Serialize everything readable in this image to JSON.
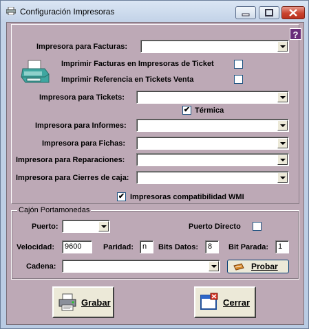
{
  "window": {
    "title": "Configuración Impresoras"
  },
  "help": {
    "label": "?"
  },
  "facturas": {
    "label": "Impresora para Facturas:",
    "value": "",
    "imprimir_ticket_label": "Imprimir Facturas en Impresoras de Ticket",
    "imprimir_ticket_checked": false,
    "imprimir_ref_label": "Imprimir Referencia en Tickets Venta",
    "imprimir_ref_checked": false
  },
  "tickets": {
    "label": "Impresora para Tickets:",
    "value": "",
    "termica_label": "Térmica",
    "termica_checked": true
  },
  "informes": {
    "label": "Impresora para Informes:",
    "value": ""
  },
  "fichas": {
    "label": "Impresora para Fichas:",
    "value": ""
  },
  "reparaciones": {
    "label": "Impresora para Reparaciones:",
    "value": ""
  },
  "cierres": {
    "label": "Impresora para Cierres de caja:",
    "value": ""
  },
  "wmi": {
    "label": "Impresoras compatibilidad WMI",
    "checked": true
  },
  "cajon": {
    "title": "Cajón Portamonedas",
    "puerto_label": "Puerto:",
    "puerto_value": "",
    "puerto_directo_label": "Puerto Directo",
    "puerto_directo_checked": false,
    "velocidad_label": "Velocidad:",
    "velocidad_value": "9600",
    "paridad_label": "Paridad:",
    "paridad_value": "n",
    "bits_datos_label": "Bits Datos:",
    "bits_datos_value": "8",
    "bit_parada_label": "Bit Parada:",
    "bit_parada_value": "1",
    "cadena_label": "Cadena:",
    "cadena_value": "",
    "probar_label": "Probar"
  },
  "actions": {
    "grabar_label": "Grabar",
    "cerrar_label": "Cerrar"
  },
  "checkmark": "✔"
}
